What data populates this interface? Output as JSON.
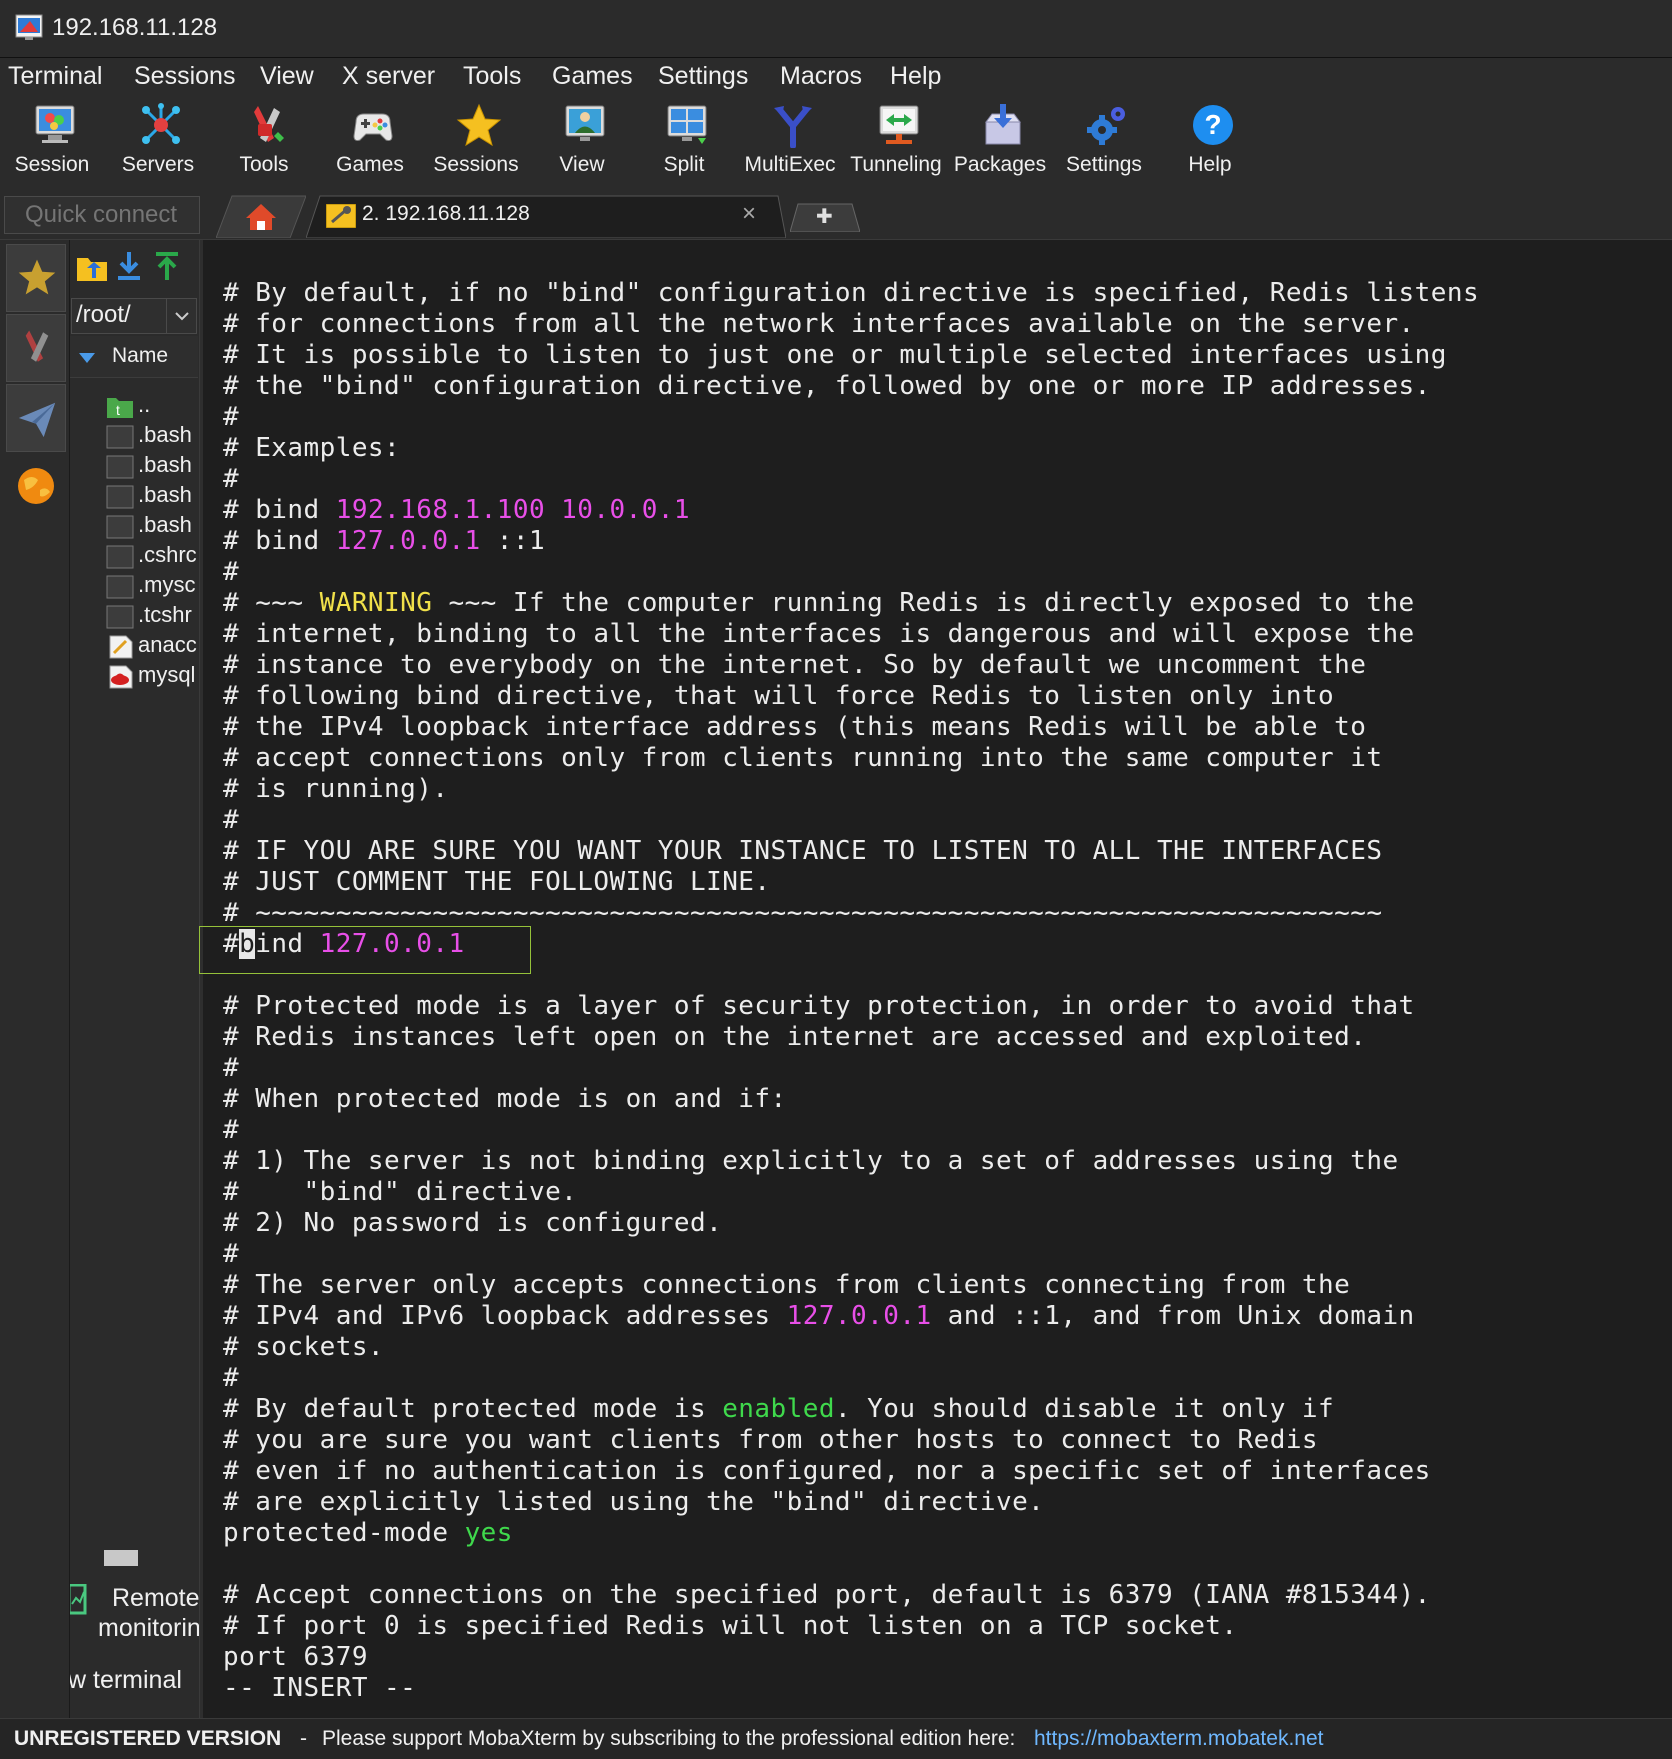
{
  "window": {
    "title": "192.168.11.128"
  },
  "menu": [
    "Terminal",
    "Sessions",
    "View",
    "X server",
    "Tools",
    "Games",
    "Settings",
    "Macros",
    "Help"
  ],
  "toolbar": [
    {
      "label": "Session",
      "icon": "session-icon"
    },
    {
      "label": "Servers",
      "icon": "servers-icon"
    },
    {
      "label": "Tools",
      "icon": "tools-icon"
    },
    {
      "label": "Games",
      "icon": "games-icon"
    },
    {
      "label": "Sessions",
      "icon": "sessions-star-icon"
    },
    {
      "label": "View",
      "icon": "view-icon"
    },
    {
      "label": "Split",
      "icon": "split-icon"
    },
    {
      "label": "MultiExec",
      "icon": "multiexec-icon"
    },
    {
      "label": "Tunneling",
      "icon": "tunneling-icon"
    },
    {
      "label": "Packages",
      "icon": "packages-icon"
    },
    {
      "label": "Settings",
      "icon": "settings-icon"
    },
    {
      "label": "Help",
      "icon": "help-icon"
    }
  ],
  "quick_connect": {
    "placeholder": "Quick connect"
  },
  "tabs": {
    "session_label": "2. 192.168.11.128",
    "close_glyph": "×",
    "plus_glyph": "✚"
  },
  "filebrowser": {
    "path": "/root/",
    "column_header": "Name",
    "files": [
      {
        "name": "..",
        "icon": "parent-folder-icon"
      },
      {
        "name": ".bash",
        "icon": "file-icon"
      },
      {
        "name": ".bash",
        "icon": "file-icon"
      },
      {
        "name": ".bash",
        "icon": "file-icon"
      },
      {
        "name": ".bash",
        "icon": "file-icon"
      },
      {
        "name": ".cshrc",
        "icon": "file-icon"
      },
      {
        "name": ".mysc",
        "icon": "file-icon"
      },
      {
        "name": ".tcshr",
        "icon": "file-icon"
      },
      {
        "name": "anacc",
        "icon": "text-file-icon"
      },
      {
        "name": "mysql",
        "icon": "redhat-package-icon"
      }
    ],
    "remote_monitoring_line1": "Remote",
    "remote_monitoring_line2": "monitorin",
    "follow_terminal": "w terminal"
  },
  "terminal": {
    "lines": [
      [
        {
          "t": "# By default, if no \"bind\" configuration directive is specified, Redis listens"
        }
      ],
      [
        {
          "t": "# for connections from all the network interfaces available on the server."
        }
      ],
      [
        {
          "t": "# It is possible to listen to just one or multiple selected interfaces using"
        }
      ],
      [
        {
          "t": "# the \"bind\" configuration directive, followed by one or more IP addresses."
        }
      ],
      [
        {
          "t": "#"
        }
      ],
      [
        {
          "t": "# Examples:"
        }
      ],
      [
        {
          "t": "#"
        }
      ],
      [
        {
          "t": "# bind "
        },
        {
          "t": "192.168.1.100 10.0.0.1",
          "c": "mag"
        }
      ],
      [
        {
          "t": "# bind "
        },
        {
          "t": "127.0.0.1",
          "c": "mag"
        },
        {
          "t": " ::1"
        }
      ],
      [
        {
          "t": "#"
        }
      ],
      [
        {
          "t": "# ~~~ "
        },
        {
          "t": "WARNING",
          "c": "yel"
        },
        {
          "t": " ~~~ If the computer running Redis is directly exposed to the"
        }
      ],
      [
        {
          "t": "# internet, binding to all the interfaces is dangerous and will expose the"
        }
      ],
      [
        {
          "t": "# instance to everybody on the internet. So by default we uncomment the"
        }
      ],
      [
        {
          "t": "# following bind directive, that will force Redis to listen only into"
        }
      ],
      [
        {
          "t": "# the IPv4 loopback interface address (this means Redis will be able to"
        }
      ],
      [
        {
          "t": "# accept connections only from clients running into the same computer it"
        }
      ],
      [
        {
          "t": "# is running)."
        }
      ],
      [
        {
          "t": "#"
        }
      ],
      [
        {
          "t": "# IF YOU ARE SURE YOU WANT YOUR INSTANCE TO LISTEN TO ALL THE INTERFACES"
        }
      ],
      [
        {
          "t": "# JUST COMMENT THE FOLLOWING LINE."
        }
      ],
      [
        {
          "t": "# ~~~~~~~~~~~~~~~~~~~~~~~~~~~~~~~~~~~~~~~~~~~~~~~~~~~~~~~~~~~~~~~~~~~~~~"
        }
      ],
      [
        {
          "t": "#"
        },
        {
          "t": "b",
          "c": "cur"
        },
        {
          "t": "ind "
        },
        {
          "t": "127.0.0.1",
          "c": "mag"
        }
      ],
      [
        {
          "t": ""
        }
      ],
      [
        {
          "t": "# Protected mode is a layer of security protection, in order to avoid that"
        }
      ],
      [
        {
          "t": "# Redis instances left open on the internet are accessed and exploited."
        }
      ],
      [
        {
          "t": "#"
        }
      ],
      [
        {
          "t": "# When protected mode is on and if:"
        }
      ],
      [
        {
          "t": "#"
        }
      ],
      [
        {
          "t": "# 1) The server is not binding explicitly to a set of addresses using the"
        }
      ],
      [
        {
          "t": "#    \"bind\" directive."
        }
      ],
      [
        {
          "t": "# 2) No password is configured."
        }
      ],
      [
        {
          "t": "#"
        }
      ],
      [
        {
          "t": "# The server only accepts connections from clients connecting from the"
        }
      ],
      [
        {
          "t": "# IPv4 and IPv6 loopback addresses "
        },
        {
          "t": "127.0.0.1",
          "c": "mag"
        },
        {
          "t": " and ::1, and from Unix domain"
        }
      ],
      [
        {
          "t": "# sockets."
        }
      ],
      [
        {
          "t": "#"
        }
      ],
      [
        {
          "t": "# By default protected mode is "
        },
        {
          "t": "enabled",
          "c": "grn"
        },
        {
          "t": ". You should disable it only if"
        }
      ],
      [
        {
          "t": "# you are sure you want clients from other hosts to connect to Redis"
        }
      ],
      [
        {
          "t": "# even if no authentication is configured, nor a specific set of interfaces"
        }
      ],
      [
        {
          "t": "# are explicitly listed using the \"bind\" directive."
        }
      ],
      [
        {
          "t": "protected-mode "
        },
        {
          "t": "yes",
          "c": "grn"
        }
      ],
      [
        {
          "t": ""
        }
      ],
      [
        {
          "t": "# Accept connections on the specified port, default is 6379 (IANA #815344)."
        }
      ],
      [
        {
          "t": "# If port 0 is specified Redis will not listen on a TCP socket."
        }
      ],
      [
        {
          "t": "port 6379"
        }
      ],
      [
        {
          "t": "-- INSERT --"
        }
      ]
    ]
  },
  "status": {
    "edition": "UNREGISTERED VERSION",
    "separator": "-",
    "message": "Please support MobaXterm by subscribing to the professional edition here:",
    "url": "https://mobaxterm.mobatek.net"
  },
  "colors": {
    "magenta": "#e84fe8",
    "yellow": "#f0e04a",
    "green": "#3fd94c",
    "link": "#6fb8ff",
    "search_border": "#95c23a"
  }
}
